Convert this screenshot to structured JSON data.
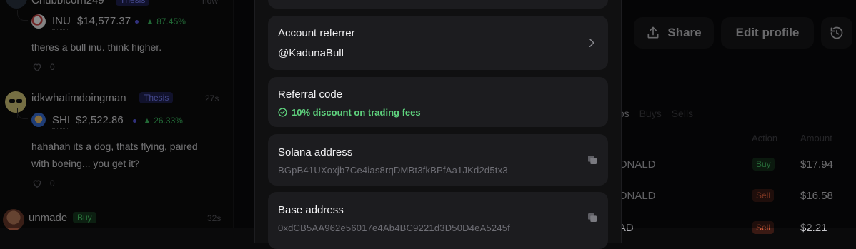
{
  "feed": {
    "posts": [
      {
        "user": "Chubbicorn249",
        "badge": "Thesis",
        "time": "now",
        "token_symbol": "INU",
        "token_value": "$14,577.37",
        "token_change": "▲ 87.45%",
        "text": "theres a bull inu. think higher.",
        "likes": "0"
      },
      {
        "user": "idkwhatimdoingman",
        "badge": "Thesis",
        "time": "27s",
        "token_symbol": "SHI",
        "token_value": "$2,522.86",
        "token_change": "▲ 26.33%",
        "text_line1": "hahahah its a dog, thats flying, paired",
        "text_line2": "with boeing... you get it?",
        "likes": "0"
      },
      {
        "user": "unmade",
        "badge": "Buy",
        "time": "32s"
      }
    ]
  },
  "modal": {
    "account_referrer": {
      "title": "Account referrer",
      "value": "@KadunaBull"
    },
    "referral_code": {
      "title": "Referral code",
      "perk": "10% discount on trading fees"
    },
    "solana": {
      "title": "Solana address",
      "address": "BGpB41UXoxjb7Ce4ias8rqDMBt3fkBPfAa1JKd2d5tx3"
    },
    "base": {
      "title": "Base address",
      "address": "0xdCB5AA962e56017e4Ab4BC9221d3D50D4eA5245f"
    }
  },
  "profile": {
    "share_label": "Share",
    "edit_label": "Edit profile",
    "tabs": [
      "aps",
      "Buys",
      "Sells"
    ],
    "columns": {
      "action": "Action",
      "amount": "Amount"
    },
    "rows": [
      {
        "name": "DONALD",
        "action": "Buy",
        "amount": "$17.94"
      },
      {
        "name": "DONALD",
        "action": "Sell",
        "amount": "$16.58"
      },
      {
        "name": "RAD",
        "action": "Sell",
        "amount": "$2.21"
      }
    ]
  },
  "colors": {
    "accent_green": "#5fd37e",
    "buy_green": "#48c267",
    "sell_orange": "#e0633f",
    "thesis_purple": "#7c84ff"
  }
}
